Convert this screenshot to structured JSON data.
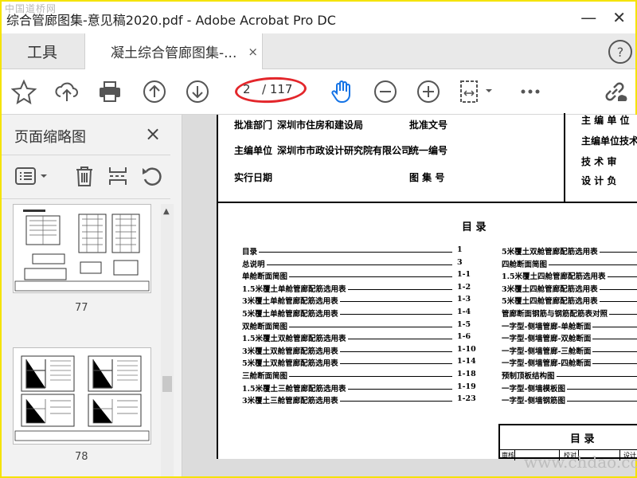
{
  "window": {
    "title": "综合管廊图集-意见稿2020.pdf - Adobe Acrobat Pro DC",
    "watermark_top": "中国道桥网",
    "watermark_bottom": "www.chdao.com"
  },
  "tabs": {
    "tools": "工具",
    "document": "凝土综合管廊图集-...",
    "close": "×",
    "help": "?"
  },
  "toolbar": {
    "current_page": "2",
    "total_pages": "/ 117"
  },
  "sidepanel": {
    "title": "页面缩略图",
    "close": "×",
    "thumbnails": [
      {
        "page": "77"
      },
      {
        "page": "78"
      }
    ]
  },
  "document": {
    "header_rows": [
      {
        "label": "批准部门",
        "value": "深圳市住房和建设局",
        "right_label": "批准文号"
      },
      {
        "label": "主编单位",
        "value": "深圳市市政设计研究院有限公司",
        "right_label": "统一编号"
      },
      {
        "label": "实行日期",
        "value": "",
        "right_label": "图 集 号"
      }
    ],
    "right_header": [
      "主 编 单 位",
      "主编单位技术",
      "技 术 审",
      "设 计 负"
    ],
    "toc_title": "目    录",
    "toc_left": [
      {
        "name": "目录",
        "page": "1"
      },
      {
        "name": "总说明",
        "page": "3"
      },
      {
        "name": "单舱断面简图",
        "page": "1-1"
      },
      {
        "name": "1.5米覆土单舱管廊配筋选用表",
        "page": "1-2"
      },
      {
        "name": "3米覆土单舱管廊配筋选用表",
        "page": "1-3"
      },
      {
        "name": "5米覆土单舱管廊配筋选用表",
        "page": "1-4"
      },
      {
        "name": "双舱断面简图",
        "page": "1-5"
      },
      {
        "name": "1.5米覆土双舱管廊配筋选用表",
        "page": "1-6"
      },
      {
        "name": "3米覆土双舱管廊配筋选用表",
        "page": "1-10"
      },
      {
        "name": "5米覆土双舱管廊配筋选用表",
        "page": "1-14"
      },
      {
        "name": "三舱断面简图",
        "page": "1-18"
      },
      {
        "name": "1.5米覆土三舱管廊配筋选用表",
        "page": "1-19"
      },
      {
        "name": "3米覆土三舱管廊配筋选用表",
        "page": "1-23"
      }
    ],
    "toc_right": [
      "5米覆土双舱管廊配筋选用表",
      "四舱断面简图",
      "1.5米覆土四舱管廊配筋选用表",
      "3米覆土四舱管廊配筋选用表",
      "5米覆土四舱管廊配筋选用表",
      "管廊断面钢筋与钢筋配筋表对照",
      "一字型-侧墙管廊-单舱断面",
      "一字型-侧墙管廊-双舱断面",
      "一字型-侧墙管廊-三舱断面",
      "一字型-侧墙管廊-四舱断面",
      "预制顶板结构图",
      "一字型-侧墙模板图",
      "一字型-侧墙钢筋图"
    ],
    "titleblock": {
      "title": "目  录",
      "cells": [
        "审核",
        "校对",
        "设计"
      ]
    }
  },
  "colors": {
    "highlight_ring": "#e3262b",
    "hand_tool": "#1473e6",
    "frame": "#f5e300"
  }
}
